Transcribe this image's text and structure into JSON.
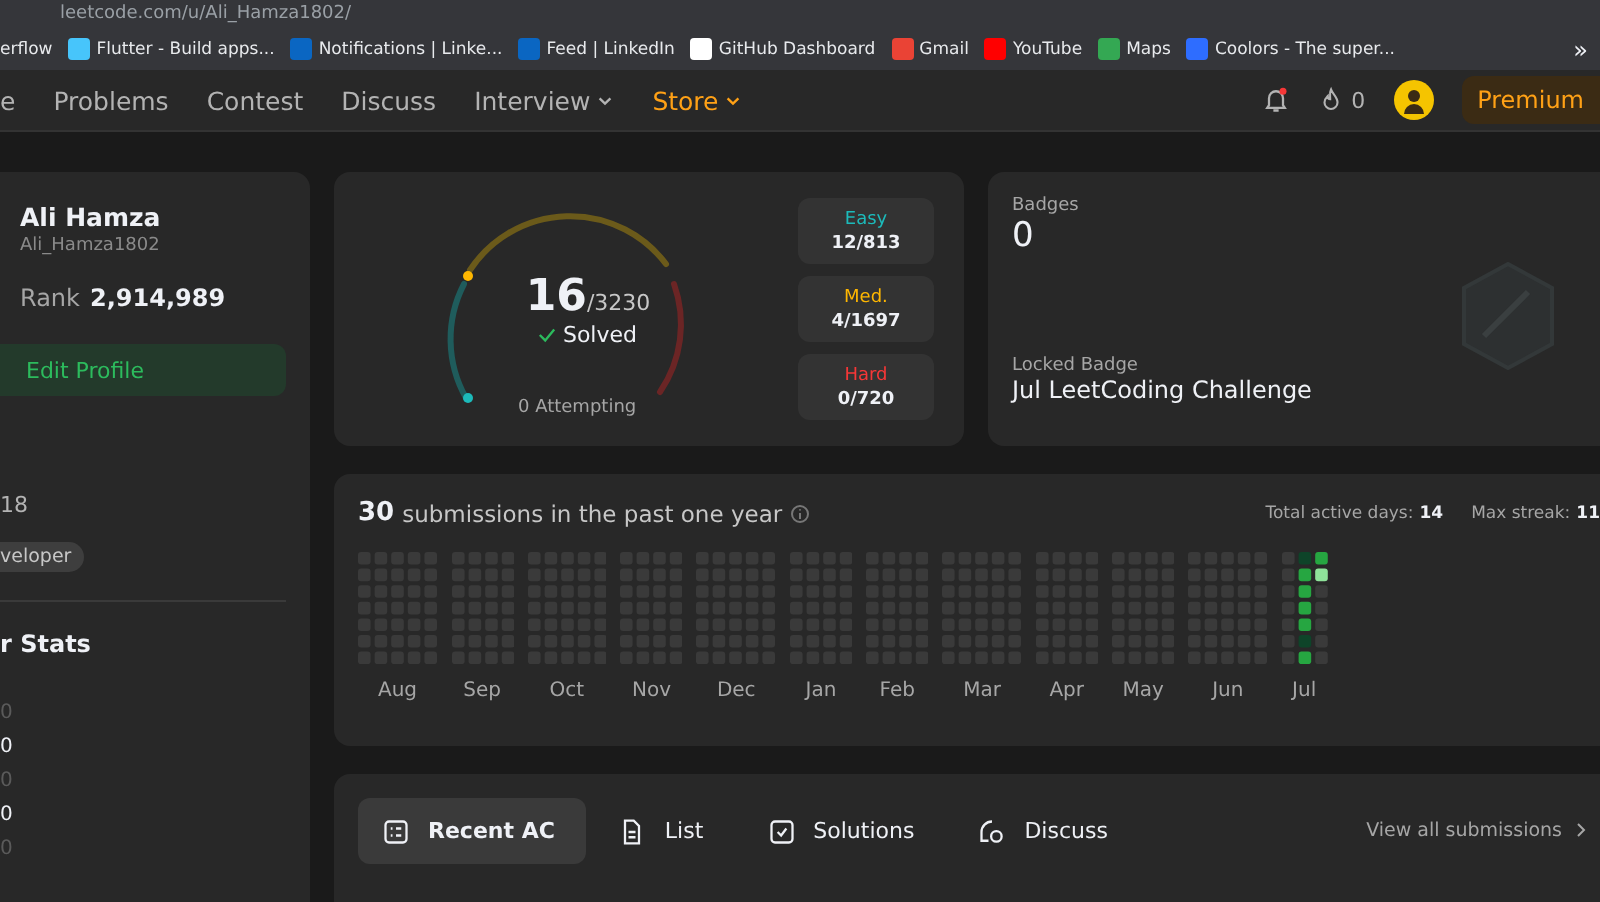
{
  "browser": {
    "url": "leetcode.com/u/Ali_Hamza1802/",
    "bookmarks": [
      {
        "label": "erflow",
        "kind": "plain"
      },
      {
        "label": "Flutter - Build apps...",
        "kind": "flutter"
      },
      {
        "label": "Notifications | Linke...",
        "kind": "linkedin"
      },
      {
        "label": "Feed | LinkedIn",
        "kind": "linkedin"
      },
      {
        "label": "GitHub Dashboard",
        "kind": "github"
      },
      {
        "label": "Gmail",
        "kind": "gmail"
      },
      {
        "label": "YouTube",
        "kind": "youtube"
      },
      {
        "label": "Maps",
        "kind": "maps"
      },
      {
        "label": "Coolors - The super...",
        "kind": "coolors"
      }
    ],
    "more": "»"
  },
  "nav": {
    "items": [
      {
        "label": "e",
        "dropdown": false,
        "highlight": false
      },
      {
        "label": "Problems",
        "dropdown": false,
        "highlight": false
      },
      {
        "label": "Contest",
        "dropdown": false,
        "highlight": false
      },
      {
        "label": "Discuss",
        "dropdown": false,
        "highlight": false
      },
      {
        "label": "Interview",
        "dropdown": true,
        "highlight": false
      },
      {
        "label": "Store",
        "dropdown": true,
        "highlight": true
      }
    ],
    "notification_unread": true,
    "streak": "0",
    "premium": "Premium"
  },
  "profile": {
    "name": "Ali Hamza",
    "username": "Ali_Hamza1802",
    "rank_label": "Rank",
    "rank": "2,914,989",
    "edit": "Edit Profile",
    "field_1": "18",
    "tag": "veloper",
    "stats_title": "r Stats",
    "stats": [
      "0",
      "0",
      "0",
      "0",
      "0"
    ]
  },
  "solved": {
    "count": "16",
    "total": "/3230",
    "label": "Solved",
    "attempting": "0 Attempting",
    "levels": [
      {
        "kind": "easy",
        "label": "Easy",
        "value": "12/813"
      },
      {
        "kind": "medium",
        "label": "Med.",
        "value": "4/1697"
      },
      {
        "kind": "hard",
        "label": "Hard",
        "value": "0/720"
      }
    ]
  },
  "badges": {
    "title": "Badges",
    "count": "0",
    "locked_label": "Locked Badge",
    "locked_name": "Jul LeetCoding Challenge"
  },
  "calendar": {
    "count": "30",
    "label": "submissions in the past one year",
    "active_label": "Total active days:",
    "active": "14",
    "streak_label": "Max streak:",
    "streak": "11",
    "months": [
      "Aug",
      "Sep",
      "Oct",
      "Nov",
      "Dec",
      "Jan",
      "Feb",
      "Mar",
      "Apr",
      "May",
      "Jun",
      "Jul"
    ]
  },
  "tabs": [
    {
      "label": "Recent AC",
      "kind": "list",
      "selected": true
    },
    {
      "label": "List",
      "kind": "file",
      "selected": false
    },
    {
      "label": "Solutions",
      "kind": "check",
      "selected": false
    },
    {
      "label": "Discuss",
      "kind": "chat",
      "selected": false
    }
  ],
  "view_all": "View all submissions"
}
